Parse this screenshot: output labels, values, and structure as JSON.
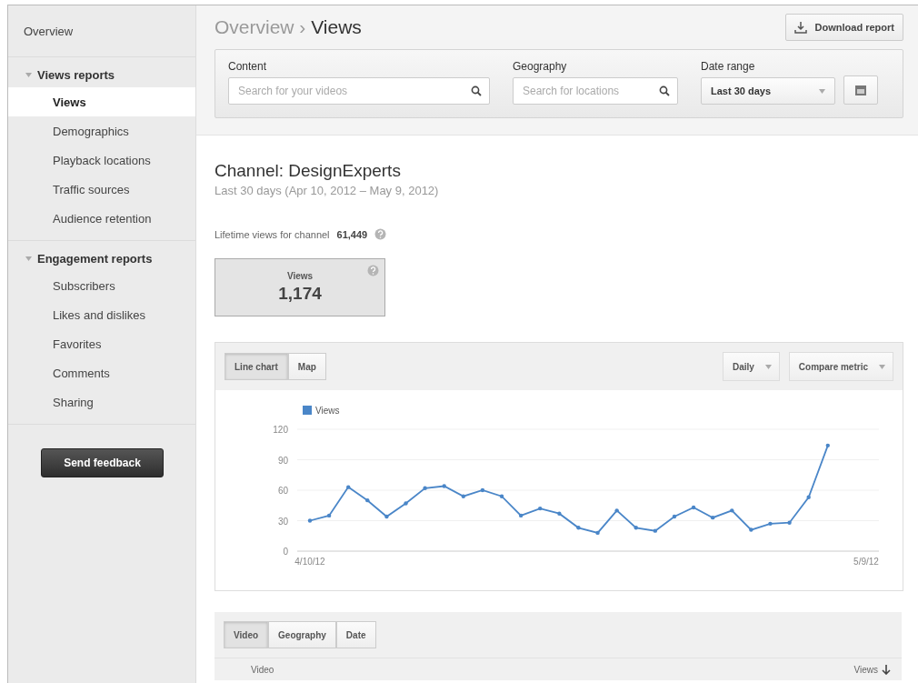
{
  "sidebar": {
    "items": [
      {
        "label": "Overview",
        "selected": false
      }
    ],
    "groups": [
      {
        "label": "Views reports",
        "expanded": true,
        "items": [
          {
            "label": "Views",
            "selected": true
          },
          {
            "label": "Demographics",
            "selected": false
          },
          {
            "label": "Playback locations",
            "selected": false
          },
          {
            "label": "Traffic sources",
            "selected": false
          },
          {
            "label": "Audience retention",
            "selected": false
          }
        ]
      },
      {
        "label": "Engagement reports",
        "expanded": true,
        "items": [
          {
            "label": "Subscribers",
            "selected": false
          },
          {
            "label": "Likes and dislikes",
            "selected": false
          },
          {
            "label": "Favorites",
            "selected": false
          },
          {
            "label": "Comments",
            "selected": false
          },
          {
            "label": "Sharing",
            "selected": false
          }
        ]
      }
    ],
    "feedback_button": "Send feedback"
  },
  "breadcrumb": {
    "parent": "Overview",
    "separator": "›",
    "current": "Views"
  },
  "download_button": "Download report",
  "filters": {
    "content": {
      "label": "Content",
      "placeholder": "Search for your videos"
    },
    "geography": {
      "label": "Geography",
      "placeholder": "Search for locations"
    },
    "date_range": {
      "label": "Date range",
      "value": "Last 30 days"
    }
  },
  "channel": {
    "title": "Channel: DesignExperts",
    "period": "Last 30 days (Apr 10, 2012 – May 9, 2012)",
    "lifetime_label": "Lifetime views for channel",
    "lifetime_value": "61,449"
  },
  "metric_card": {
    "label": "Views",
    "value": "1,174"
  },
  "chart_panel": {
    "view_tabs": [
      {
        "label": "Line chart",
        "selected": true
      },
      {
        "label": "Map",
        "selected": false
      }
    ],
    "dropdowns": [
      "Daily",
      "Compare metric"
    ],
    "chart_data": {
      "type": "line",
      "categories": [
        "4/10/12",
        null,
        null,
        null,
        null,
        null,
        null,
        null,
        null,
        null,
        null,
        null,
        null,
        null,
        null,
        null,
        null,
        null,
        null,
        null,
        null,
        null,
        null,
        null,
        null,
        null,
        null,
        null,
        null,
        "5/9/12"
      ],
      "series": [
        {
          "name": "Views",
          "color": "#4a86c8",
          "values": [
            30,
            35,
            63,
            50,
            34,
            47,
            62,
            64,
            54,
            60,
            54,
            35,
            42,
            37,
            23,
            18,
            40,
            23,
            20,
            34,
            43,
            33,
            40,
            21,
            27,
            28,
            53,
            104,
            null,
            null
          ]
        }
      ],
      "ylim": [
        0,
        120
      ],
      "yticks": [
        0,
        30,
        60,
        90,
        120
      ],
      "grid": true
    }
  },
  "table_panel": {
    "tabs": [
      {
        "label": "Video",
        "selected": true
      },
      {
        "label": "Geography",
        "selected": false
      },
      {
        "label": "Date",
        "selected": false
      }
    ],
    "columns": [
      "Video",
      "Views"
    ]
  }
}
